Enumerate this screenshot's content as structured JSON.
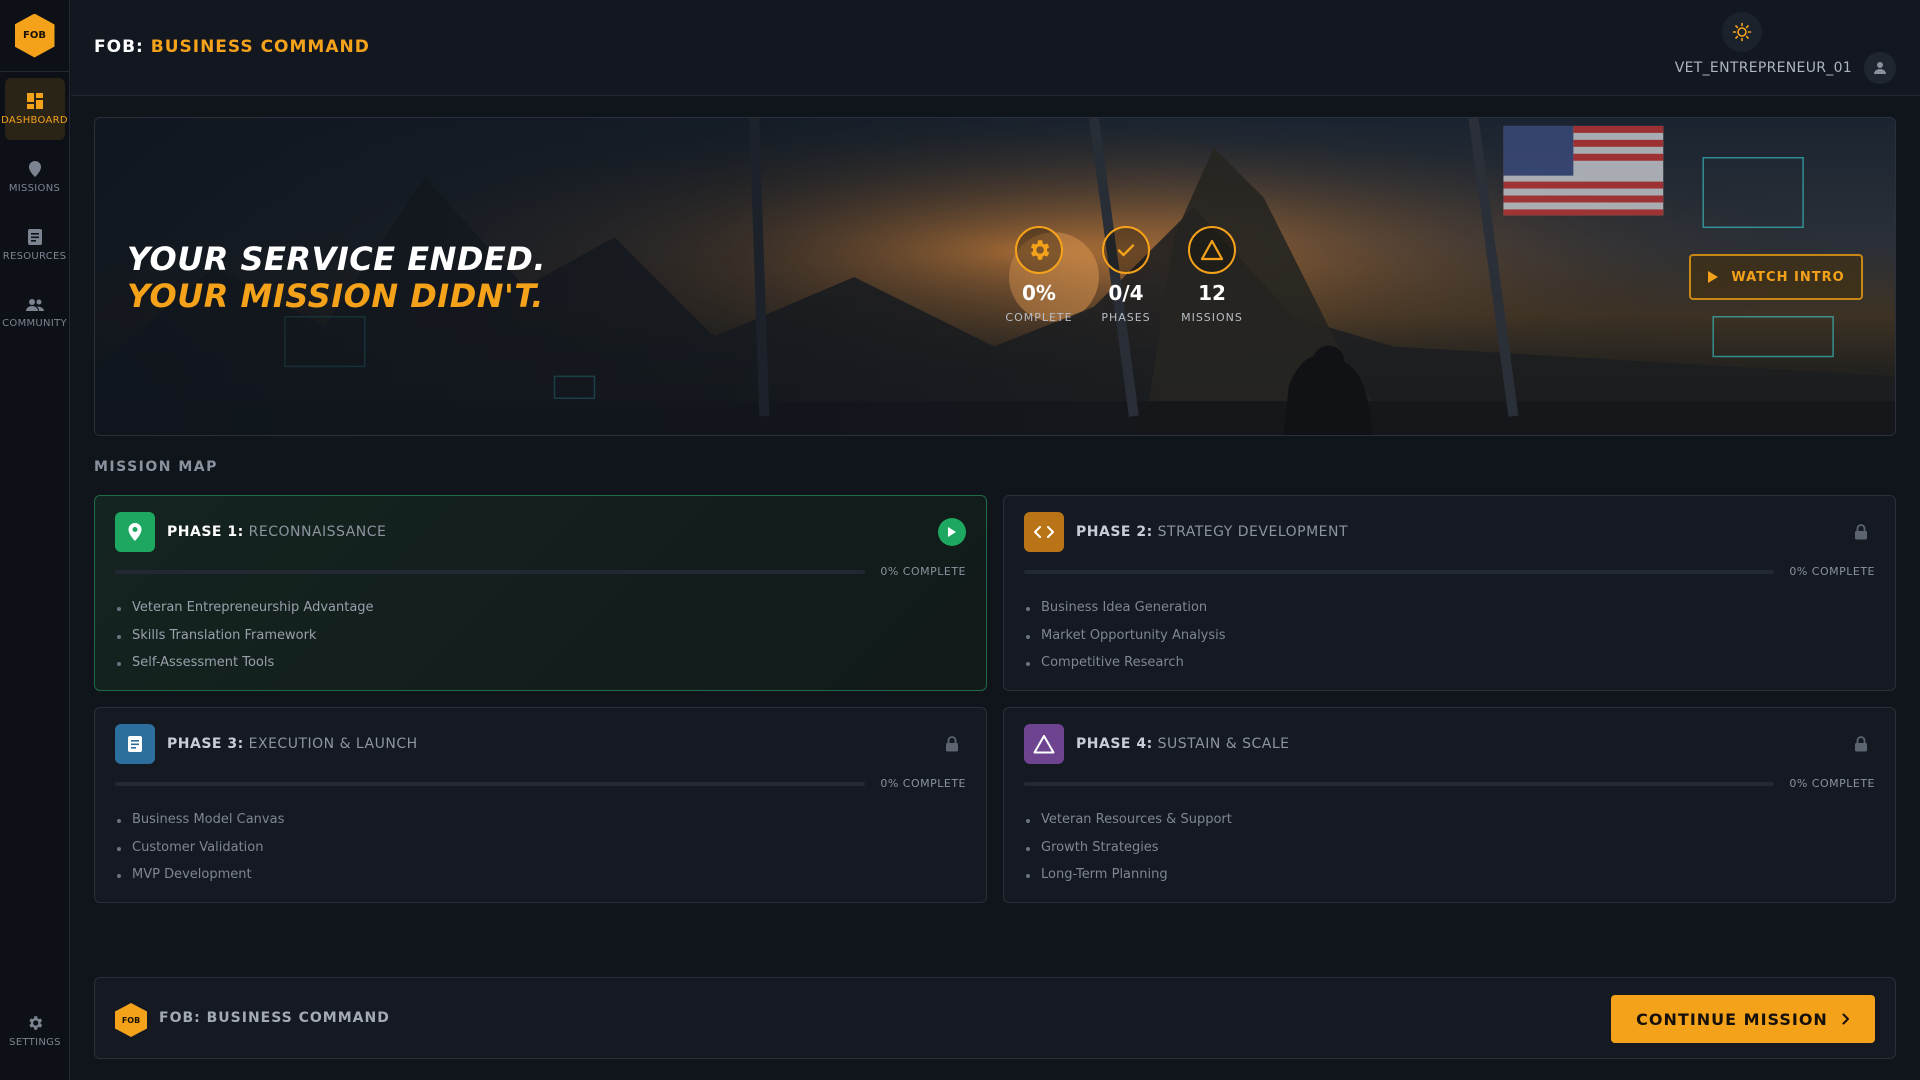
{
  "app": {
    "logo_text": "FOB",
    "title_prefix": "FOB:",
    "title_accent": "BUSINESS COMMAND"
  },
  "sidebar": {
    "items": [
      {
        "label": "DASHBOARD",
        "icon": "dashboard-icon",
        "active": true
      },
      {
        "label": "MISSIONS",
        "icon": "map-pin-icon",
        "active": false
      },
      {
        "label": "RESOURCES",
        "icon": "document-icon",
        "active": false
      },
      {
        "label": "COMMUNITY",
        "icon": "people-icon",
        "active": false
      }
    ],
    "settings_label": "SETTINGS"
  },
  "header": {
    "username": "VET_ENTREPRENEUR_01",
    "theme_icon": "sun-icon",
    "avatar_icon": "user-icon"
  },
  "hero": {
    "line1": "YOUR SERVICE ENDED.",
    "line2": "YOUR MISSION DIDN'T.",
    "stats": [
      {
        "value": "0%",
        "label": "COMPLETE",
        "icon": "gear-icon"
      },
      {
        "value": "0/4",
        "label": "PHASES",
        "icon": "check-icon"
      },
      {
        "value": "12",
        "label": "MISSIONS",
        "icon": "triangle-icon"
      }
    ],
    "watch_label": "WATCH INTRO"
  },
  "mission_map": {
    "title": "MISSION MAP",
    "phases": [
      {
        "number_label": "PHASE 1:",
        "name": "RECONNAISSANCE",
        "icon": "map-pin-icon",
        "color": "#1ea760",
        "status": "available",
        "progress": 0,
        "progress_label": "0% COMPLETE",
        "tasks": [
          "Veteran Entrepreneurship Advantage",
          "Skills Translation Framework",
          "Self-Assessment Tools"
        ]
      },
      {
        "number_label": "PHASE 2:",
        "name": "STRATEGY DEVELOPMENT",
        "icon": "code-icon",
        "color": "#b87416",
        "status": "locked",
        "progress": 0,
        "progress_label": "0% COMPLETE",
        "tasks": [
          "Business Idea Generation",
          "Market Opportunity Analysis",
          "Competitive Research"
        ]
      },
      {
        "number_label": "PHASE 3:",
        "name": "EXECUTION & LAUNCH",
        "icon": "document-icon",
        "color": "#2c6e9e",
        "status": "locked",
        "progress": 0,
        "progress_label": "0% COMPLETE",
        "tasks": [
          "Business Model Canvas",
          "Customer Validation",
          "MVP Development"
        ]
      },
      {
        "number_label": "PHASE 4:",
        "name": "SUSTAIN & SCALE",
        "icon": "triangle-icon",
        "color": "#6e4390",
        "status": "locked",
        "progress": 0,
        "progress_label": "0% COMPLETE",
        "tasks": [
          "Veteran Resources & Support",
          "Growth Strategies",
          "Long-Term Planning"
        ]
      }
    ]
  },
  "footer": {
    "logo_text": "FOB",
    "name": "FOB: BUSINESS COMMAND",
    "cta_label": "CONTINUE MISSION"
  }
}
